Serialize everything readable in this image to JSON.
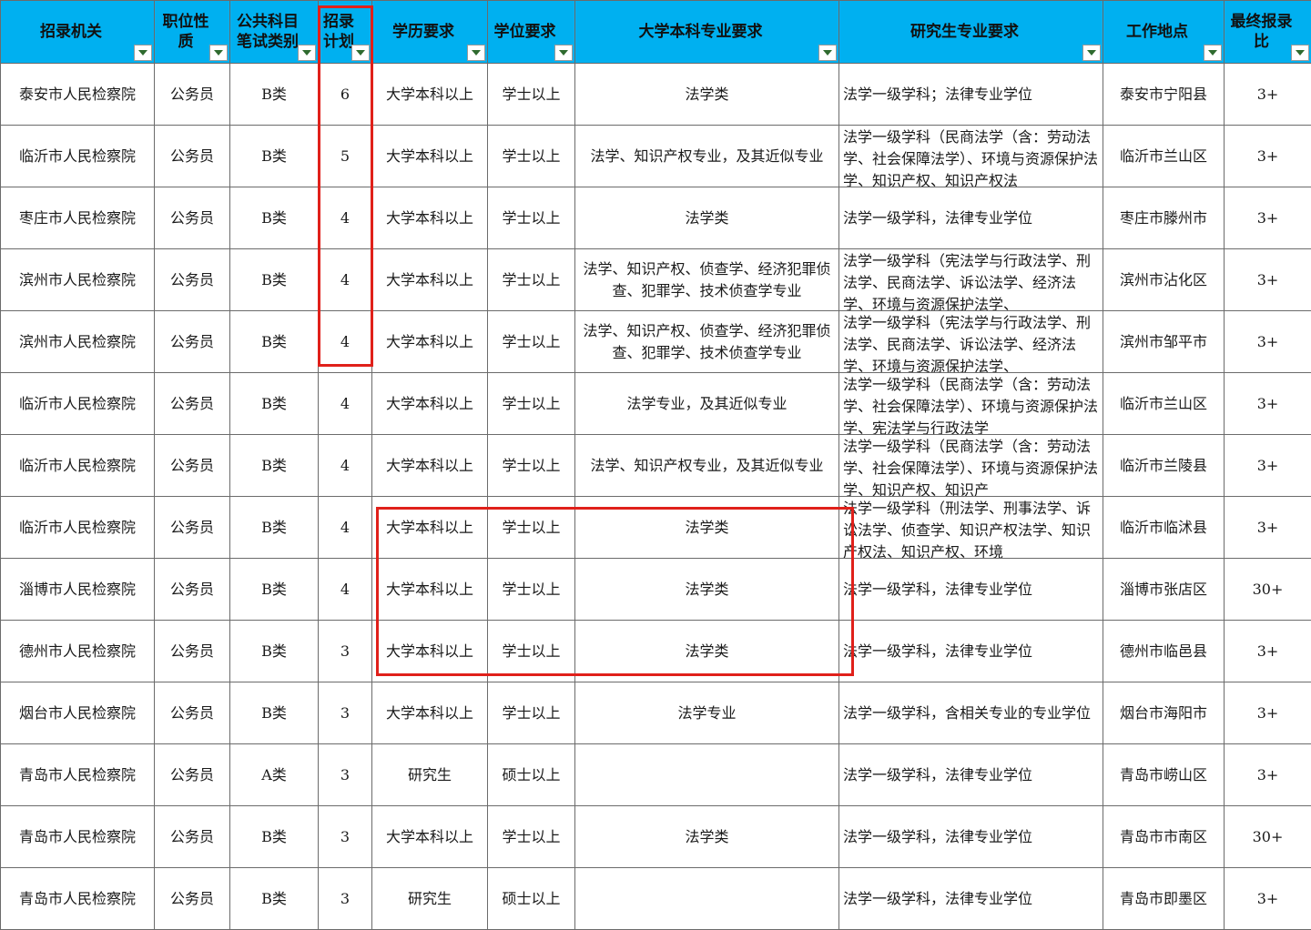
{
  "headers": [
    {
      "label": "招录机关",
      "filter_icon": "dropdown-arrow-icon"
    },
    {
      "label": "职位性质",
      "filter_icon": "dropdown-arrow-icon"
    },
    {
      "label": "公共科目笔试类别",
      "filter_icon": "dropdown-arrow-icon"
    },
    {
      "label": "招录计划",
      "filter_icon": "dropdown-arrow-icon"
    },
    {
      "label": "学历要求",
      "filter_icon": "dropdown-arrow-icon"
    },
    {
      "label": "学位要求",
      "filter_icon": "dropdown-arrow-icon"
    },
    {
      "label": "大学本科专业要求",
      "filter_icon": "dropdown-arrow-icon"
    },
    {
      "label": "研究生专业要求",
      "filter_icon": "dropdown-arrow-icon"
    },
    {
      "label": "工作地点",
      "filter_icon": "dropdown-arrow-icon"
    },
    {
      "label": "最终报录比",
      "filter_icon": "dropdown-arrow-icon"
    }
  ],
  "rows": [
    [
      "泰安市人民检察院",
      "公务员",
      "B类",
      "6",
      "大学本科以上",
      "学士以上",
      "法学类",
      "法学一级学科；法律专业学位",
      "泰安市宁阳县",
      "3+"
    ],
    [
      "临沂市人民检察院",
      "公务员",
      "B类",
      "5",
      "大学本科以上",
      "学士以上",
      "法学、知识产权专业，及其近似专业",
      "法学一级学科（民商法学（含：劳动法学、社会保障法学）、环境与资源保护法学、知识产权、知识产权法",
      "临沂市兰山区",
      "3+"
    ],
    [
      "枣庄市人民检察院",
      "公务员",
      "B类",
      "4",
      "大学本科以上",
      "学士以上",
      "法学类",
      "法学一级学科，法律专业学位",
      "枣庄市滕州市",
      "3+"
    ],
    [
      "滨州市人民检察院",
      "公务员",
      "B类",
      "4",
      "大学本科以上",
      "学士以上",
      "法学、知识产权、侦查学、经济犯罪侦查、犯罪学、技术侦查学专业",
      "法学一级学科（宪法学与行政法学、刑法学、民商法学、诉讼法学、经济法学、环境与资源保护法学、",
      "滨州市沾化区",
      "3+"
    ],
    [
      "滨州市人民检察院",
      "公务员",
      "B类",
      "4",
      "大学本科以上",
      "学士以上",
      "法学、知识产权、侦查学、经济犯罪侦查、犯罪学、技术侦查学专业",
      "法学一级学科（宪法学与行政法学、刑法学、民商法学、诉讼法学、经济法学、环境与资源保护法学、",
      "滨州市邹平市",
      "3+"
    ],
    [
      "临沂市人民检察院",
      "公务员",
      "B类",
      "4",
      "大学本科以上",
      "学士以上",
      "法学专业，及其近似专业",
      "法学一级学科（民商法学（含：劳动法学、社会保障法学）、环境与资源保护法学、宪法学与行政法学",
      "临沂市兰山区",
      "3+"
    ],
    [
      "临沂市人民检察院",
      "公务员",
      "B类",
      "4",
      "大学本科以上",
      "学士以上",
      "法学、知识产权专业，及其近似专业",
      "法学一级学科（民商法学（含：劳动法学、社会保障法学）、环境与资源保护法学、知识产权、知识产",
      "临沂市兰陵县",
      "3+"
    ],
    [
      "临沂市人民检察院",
      "公务员",
      "B类",
      "4",
      "大学本科以上",
      "学士以上",
      "法学类",
      "法学一级学科（刑法学、刑事法学、诉讼法学、侦查学、知识产权法学、知识产权法、知识产权、环境",
      "临沂市临沭县",
      "3+"
    ],
    [
      "淄博市人民检察院",
      "公务员",
      "B类",
      "4",
      "大学本科以上",
      "学士以上",
      "法学类",
      "法学一级学科，法律专业学位",
      "淄博市张店区",
      "30+"
    ],
    [
      "德州市人民检察院",
      "公务员",
      "B类",
      "3",
      "大学本科以上",
      "学士以上",
      "法学类",
      "法学一级学科，法律专业学位",
      "德州市临邑县",
      "3+"
    ],
    [
      "烟台市人民检察院",
      "公务员",
      "B类",
      "3",
      "大学本科以上",
      "学士以上",
      "法学专业",
      "法学一级学科，含相关专业的专业学位",
      "烟台市海阳市",
      "3+"
    ],
    [
      "青岛市人民检察院",
      "公务员",
      "A类",
      "3",
      "研究生",
      "硕士以上",
      "",
      "法学一级学科，法律专业学位",
      "青岛市崂山区",
      "3+"
    ],
    [
      "青岛市人民检察院",
      "公务员",
      "B类",
      "3",
      "大学本科以上",
      "学士以上",
      "法学类",
      "法学一级学科，法律专业学位",
      "青岛市市南区",
      "30+"
    ],
    [
      "青岛市人民检察院",
      "公务员",
      "B类",
      "3",
      "研究生",
      "硕士以上",
      "",
      "法学一级学科，法律专业学位",
      "青岛市即墨区",
      "3+"
    ]
  ],
  "annotation_color": "#e0201a",
  "header_color": "#00b0f0"
}
